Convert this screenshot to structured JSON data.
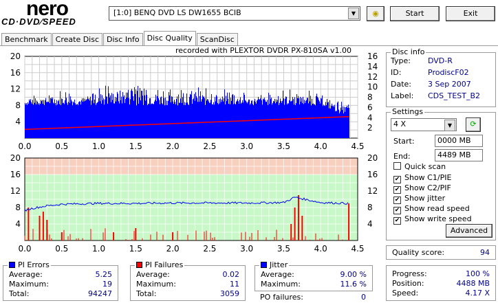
{
  "app": {
    "logo_top": "nero",
    "logo_bottom": "CD·DVD⁄SPEED",
    "drive": "[1:0]  BENQ DVD LS DW1655 BCIB",
    "start_label": "Start",
    "exit_label": "Exit"
  },
  "tabs": [
    "Benchmark",
    "Create Disc",
    "Disc Info",
    "Disc Quality",
    "ScanDisc"
  ],
  "active_tab": "Disc Quality",
  "recorded_with": "recorded with PLEXTOR DVDR   PX-810SA  v1.00",
  "disc_info": {
    "title": "Disc info",
    "type_label": "Type:",
    "type": "DVD-R",
    "id_label": "ID:",
    "id": "ProdiscF02",
    "date_label": "Date:",
    "date": "3 Sep 2007",
    "label_label": "Label:",
    "label": "CDS_TEST_B2"
  },
  "settings": {
    "title": "Settings",
    "speed": "4 X",
    "start_label": "Start:",
    "start": "0000 MB",
    "end_label": "End:",
    "end": "4489 MB",
    "quick_scan": "Quick scan",
    "show_c1": "Show C1/PIE",
    "show_c2": "Show C2/PIF",
    "show_jitter": "Show jitter",
    "show_read": "Show read speed",
    "show_write": "Show write speed",
    "advanced": "Advanced",
    "checks": {
      "quick_scan": false,
      "show_c1": true,
      "show_c2": true,
      "show_jitter": true,
      "show_read": true,
      "show_write": true
    }
  },
  "quality": {
    "label": "Quality score:",
    "value": "94"
  },
  "pi_errors": {
    "title": "PI Errors",
    "avg_label": "Average:",
    "avg": "5.25",
    "max_label": "Maximum:",
    "max": "19",
    "total_label": "Total:",
    "total": "94247",
    "color": "#0000ff"
  },
  "pi_failures": {
    "title": "PI Failures",
    "avg_label": "Average:",
    "avg": "0.02",
    "max_label": "Maximum:",
    "max": "11",
    "total_label": "Total:",
    "total": "3059",
    "color": "#ff0000"
  },
  "jitter": {
    "title": "Jitter",
    "avg_label": "Average:",
    "avg": "9.00 %",
    "max_label": "Maximum:",
    "max": "11.6 %",
    "color": "#0000ff"
  },
  "po": {
    "label": "PO failures:",
    "value": "0"
  },
  "progress": {
    "progress_label": "Progress:",
    "progress": "100 %",
    "position_label": "Position:",
    "position": "4488 MB",
    "speed_label": "Speed:",
    "speed": "4.17 X"
  },
  "chart_data": [
    {
      "type": "bar",
      "title": "PI Errors / Read speed",
      "xlabel": "GB",
      "xlim": [
        0,
        4.5
      ],
      "ylim": [
        0,
        20
      ],
      "y2lim": [
        0,
        16
      ],
      "xticks": [
        "0.0",
        "0.5",
        "1.0",
        "1.5",
        "2.0",
        "2.5",
        "3.0",
        "3.5",
        "4.0",
        "4.5"
      ],
      "yticks": [
        "20",
        "16",
        "12",
        "8",
        "4"
      ],
      "y2ticks": [
        "16",
        "14",
        "12",
        "10",
        "8",
        "6",
        "4",
        "2"
      ],
      "pie_x": [
        0,
        0.25,
        0.5,
        0.75,
        1,
        1.25,
        1.5,
        1.75,
        2,
        2.25,
        2.5,
        2.75,
        3,
        3.25,
        3.5,
        3.75,
        4,
        4.25,
        4.38
      ],
      "pie_values": [
        10,
        11,
        12,
        11,
        13,
        14,
        16,
        13,
        12,
        13,
        12,
        12,
        11,
        11,
        12,
        12,
        11,
        9,
        9
      ],
      "pie_base": [
        8,
        8,
        8,
        8,
        8,
        8,
        8,
        8,
        8,
        8,
        8,
        8,
        8,
        8,
        8,
        8,
        8,
        6,
        6
      ],
      "read_speed": {
        "x": [
          0,
          4.38
        ],
        "y": [
          1.7,
          4.2
        ]
      }
    },
    {
      "type": "bar",
      "title": "PI Failures / Jitter",
      "xlabel": "GB",
      "xlim": [
        0,
        4.5
      ],
      "ylim": [
        0,
        20
      ],
      "y2lim": [
        0,
        20
      ],
      "xticks": [
        "0.0",
        "0.5",
        "1.0",
        "1.5",
        "2.0",
        "2.5",
        "3.0",
        "3.5",
        "4.0",
        "4.5"
      ],
      "yticks": [
        "20",
        "16",
        "12",
        "8",
        "4"
      ],
      "y2ticks": [
        "20",
        "16",
        "12",
        "8",
        "4"
      ],
      "pif_spikes": {
        "x": [
          0.05,
          0.2,
          0.25,
          0.3,
          0.5,
          1.2,
          1.5,
          2.0,
          3.6,
          3.65,
          3.7,
          3.75,
          4.38
        ],
        "y": [
          8,
          6,
          7,
          5,
          2,
          2,
          3,
          2,
          4,
          8,
          11,
          6,
          9
        ]
      },
      "jitter": {
        "x": [
          0,
          0.1,
          0.3,
          0.5,
          1,
          1.5,
          2,
          2.5,
          3,
          3.5,
          3.65,
          4,
          4.38
        ],
        "y": [
          7.3,
          7.8,
          8.4,
          8.8,
          9.0,
          9.0,
          9.1,
          9.1,
          9.1,
          9.2,
          10.5,
          9.2,
          9.0
        ]
      }
    }
  ]
}
